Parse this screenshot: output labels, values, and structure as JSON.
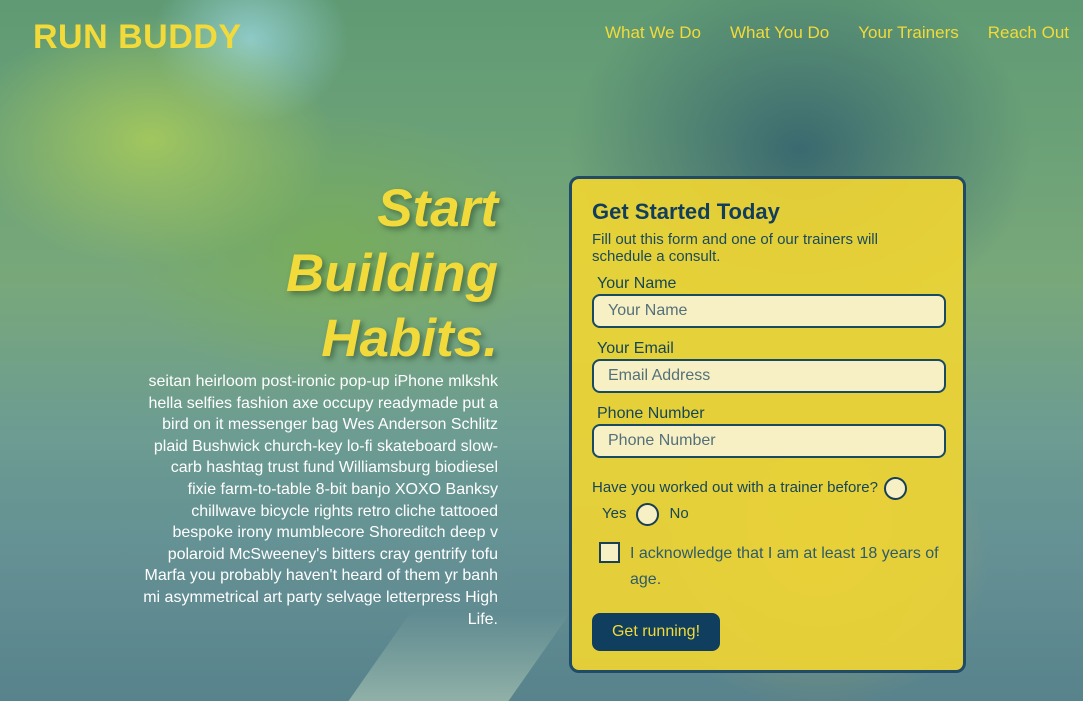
{
  "header": {
    "brand": "RUN BUDDY",
    "nav": [
      "What We Do",
      "What You Do",
      "Your Trainers",
      "Reach Out"
    ]
  },
  "hero": {
    "title_lines": [
      "Start",
      "Building",
      "Habits."
    ],
    "body": "seitan heirloom post-ironic pop-up iPhone mlkshk hella selfies fashion axe occupy readymade put a bird on it messenger bag Wes Anderson Schlitz plaid Bushwick church-key lo-fi skateboard slow-carb hashtag trust fund Williamsburg biodiesel fixie farm-to-table 8-bit banjo XOXO Banksy chillwave bicycle rights retro cliche tattooed bespoke irony mumblecore Shoreditch deep v polaroid McSweeney's bitters cray gentrify tofu Marfa you probably haven't heard of them yr banh mi asymmetrical art party selvage letterpress High Life."
  },
  "form": {
    "title": "Get Started Today",
    "subtitle": "Fill out this form and one of our trainers will schedule a consult.",
    "name": {
      "label": "Your Name",
      "placeholder": "Your Name",
      "value": ""
    },
    "email": {
      "label": "Your Email",
      "placeholder": "Email Address",
      "value": ""
    },
    "phone": {
      "label": "Phone Number",
      "placeholder": "Phone Number",
      "value": ""
    },
    "trainer_question": "Have you worked out with a trainer before?",
    "options": {
      "yes": "Yes",
      "no": "No"
    },
    "acknowledge": "I acknowledge that I am at least 18 years of age.",
    "submit_label": "Get running!"
  },
  "colors": {
    "accent_yellow": "#f2da3a",
    "navy": "#0f3e5e",
    "form_bg": "#eed434"
  }
}
